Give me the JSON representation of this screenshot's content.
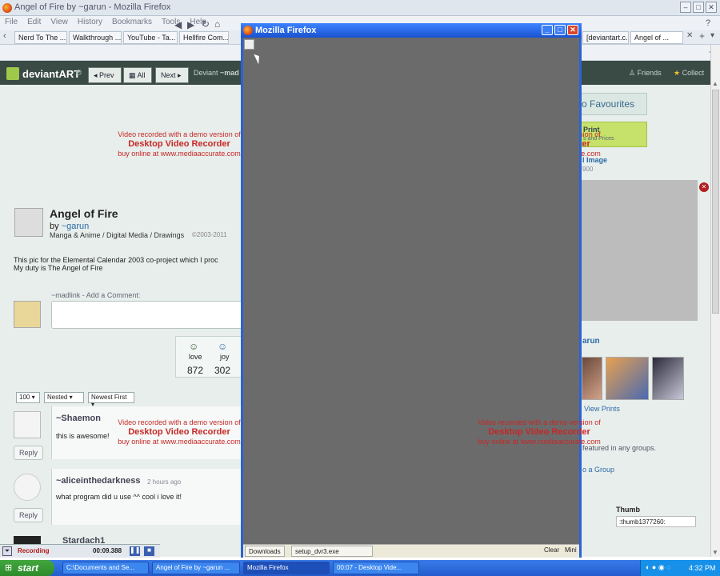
{
  "browser": {
    "title": "Angel of Fire by ~garun - Mozilla Firefox",
    "menu": [
      "File",
      "Edit",
      "View",
      "History",
      "Bookmarks",
      "Tools",
      "Help"
    ],
    "bookmarks": [
      "Nerd To The ...",
      "Walkthrough ...",
      "YouTube - Ta...",
      "Hellfire Com..."
    ],
    "tabs": [
      "[deviantart.c...",
      "Angel of ..."
    ]
  },
  "da": {
    "logo": "deviantART",
    "prev": "Prev",
    "all": "All",
    "next": "Next",
    "deviant_label": "Deviant",
    "deviant_user": "~mad",
    "friends": "Friends",
    "collect": "Collect"
  },
  "art": {
    "title": "Angel of Fire",
    "by": "by",
    "artist": "~garun",
    "category": "Manga & Anime / Digital Media / Drawings",
    "copyright": "©2003-2011",
    "description_1": "This pic for the Elemental Calendar 2003 co-project which I proc",
    "description_2": "My duty is The Angel of Fire"
  },
  "comment_form": {
    "user": "~madlink",
    "prompt": "- Add a Comment:"
  },
  "reactions": [
    {
      "label": "love",
      "count": "872"
    },
    {
      "label": "joy",
      "count": "302"
    }
  ],
  "filters": {
    "per_page": "100",
    "mode": "Nested",
    "order": "Newest First"
  },
  "comments": [
    {
      "user": "~Shaemon",
      "text": "this is awesome!",
      "reply": "Reply"
    },
    {
      "user": "~aliceinthedarkness",
      "time": "2 hours ago",
      "text": "what program did u use ^^ cool i love it!",
      "reply": "Reply"
    },
    {
      "user": "Stardach1"
    }
  ],
  "sidebar": {
    "favourites": "o Favourites",
    "print_title": "Print",
    "print_sub": "s and Prices",
    "image_label": "l Image",
    "image_size": "900",
    "artist_short": "arun",
    "view_prints": "View Prints",
    "groups_text": "featured in any groups.",
    "group_link": "o a Group",
    "thumb_label": "Thumb",
    "thumb_code": ":thumb1377260:"
  },
  "watermark": {
    "line1": "Video recorded with a demo version of",
    "line2": "Desktop Video Recorder",
    "line3": "buy online at www.mediaaccurate.com"
  },
  "inner_window": {
    "title": "Mozilla Firefox",
    "downloads": "Downloads",
    "file": "setup_dvr3.exe",
    "clear": "Clear",
    "mini": "Mini"
  },
  "recorder": {
    "status": "Recording",
    "time": "00:09.388"
  },
  "taskbar": {
    "start": "start",
    "tasks": [
      "C:\\Documents and Se...",
      "Angel of Fire by ~garun ...",
      "Mozilla Firefox",
      "00:07 - Desktop Vide..."
    ],
    "clock": "4:32 PM"
  }
}
